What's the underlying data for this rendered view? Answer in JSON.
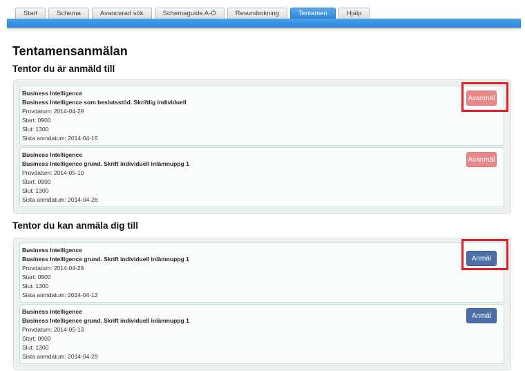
{
  "tabs": [
    {
      "label": "Start"
    },
    {
      "label": "Schema"
    },
    {
      "label": "Avancerad sök"
    },
    {
      "label": "Schemaguide A-Ö"
    },
    {
      "label": "Resursbokning"
    },
    {
      "label": "Tentamen",
      "active": true
    },
    {
      "label": "Hjälp"
    }
  ],
  "page_title": "Tentamensanmälan",
  "registered": {
    "heading": "Tentor du är anmäld till",
    "button_label": "Avanmäl",
    "items": [
      {
        "course": "Business Intelligence",
        "exam": "Business Intelligence som beslutsstöd. Skriftlig individuell",
        "date": "Provdatum: 2014-04-29",
        "start": "Start: 0900",
        "end": "Slut: 1300",
        "deadline": "Sista anmdatum: 2014-04-15"
      },
      {
        "course": "Business Intelligence",
        "exam": "Business Intelligence grund. Skrift individuell inlämnuppg 1",
        "date": "Provdatum: 2014-05-10",
        "start": "Start: 0900",
        "end": "Slut: 1300",
        "deadline": "Sista anmdatum: 2014-04-26"
      }
    ]
  },
  "available": {
    "heading": "Tentor du kan anmäla dig till",
    "button_label": "Anmäl",
    "items": [
      {
        "course": "Business Intelligence",
        "exam": "Business Intelligence grund. Skrift individuell inlämnuppg 1",
        "date": "Provdatum: 2014-04-26",
        "start": "Start: 0900",
        "end": "Slut: 1300",
        "deadline": "Sista anmdatum: 2014-04-12"
      },
      {
        "course": "Business Intelligence",
        "exam": "Business Intelligence grund. Skrift individuell inlämnuppg 1",
        "date": "Provdatum: 2014-05-13",
        "start": "Start: 0900",
        "end": "Slut: 1300",
        "deadline": "Sista anmdatum: 2014-04-29"
      }
    ]
  },
  "colors": {
    "tab_active": "#2c84d6",
    "unregister_button": "#e98888",
    "register_button": "#4d6fa8",
    "highlight_box": "#e41e26"
  }
}
